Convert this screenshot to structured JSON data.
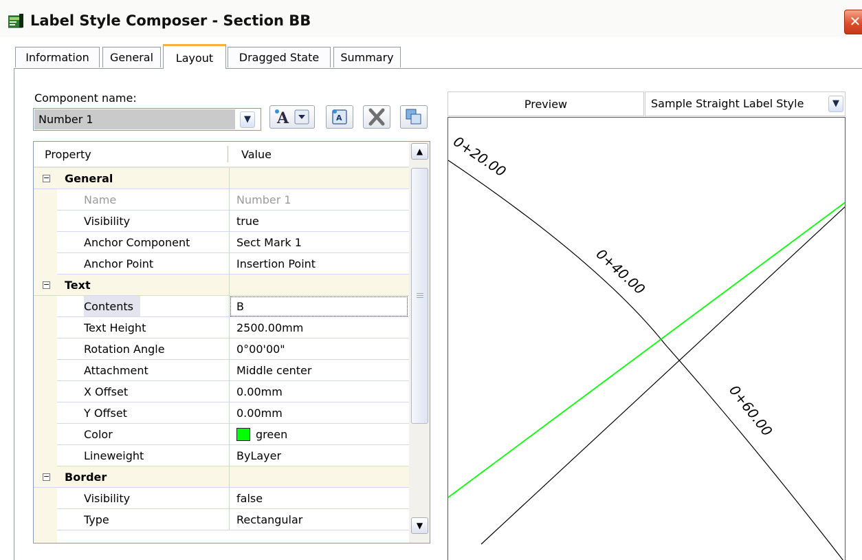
{
  "window": {
    "title": "Label Style Composer - Section BB",
    "close_glyph": "✕"
  },
  "tabs": [
    {
      "label": "Information"
    },
    {
      "label": "General"
    },
    {
      "label": "Layout",
      "active": true
    },
    {
      "label": "Dragged State"
    },
    {
      "label": "Summary"
    }
  ],
  "component": {
    "label": "Component name:",
    "selected": "Number 1"
  },
  "toolbar": {
    "text_component_icon": "text-component-icon",
    "copy_icon": "copy-component-icon",
    "delete_icon": "delete-icon",
    "arrange_icon": "component-draw-order-icon"
  },
  "grid": {
    "header": {
      "property": "Property",
      "value": "Value"
    },
    "rows": [
      {
        "type": "category",
        "label": "General",
        "toggle": "−"
      },
      {
        "property": "Name",
        "value": "Number 1",
        "disabled": true
      },
      {
        "property": "Visibility",
        "value": "true"
      },
      {
        "property": "Anchor Component",
        "value": "Sect Mark 1"
      },
      {
        "property": "Anchor Point",
        "value": "Insertion Point"
      },
      {
        "type": "category",
        "label": "Text",
        "toggle": "−"
      },
      {
        "property": "Contents",
        "value": "B",
        "selected": true
      },
      {
        "property": "Text Height",
        "value": "2500.00mm"
      },
      {
        "property": "Rotation Angle",
        "value": "0°00'00\""
      },
      {
        "property": "Attachment",
        "value": "Middle center"
      },
      {
        "property": "X Offset",
        "value": "0.00mm"
      },
      {
        "property": "Y Offset",
        "value": "0.00mm"
      },
      {
        "property": "Color",
        "value": "green",
        "swatch": "#00ff00"
      },
      {
        "property": "Lineweight",
        "value": "ByLayer"
      },
      {
        "type": "category",
        "label": "Border",
        "toggle": "−"
      },
      {
        "property": "Visibility",
        "value": "false"
      },
      {
        "property": "Type",
        "value": "Rectangular"
      }
    ]
  },
  "preview": {
    "label": "Preview",
    "style": "Sample Straight Label Style",
    "station_labels": [
      "0+20.00",
      "0+40.00",
      "0+60.00"
    ],
    "section_line_color": "#00ff00",
    "alignment_color": "#000000"
  }
}
